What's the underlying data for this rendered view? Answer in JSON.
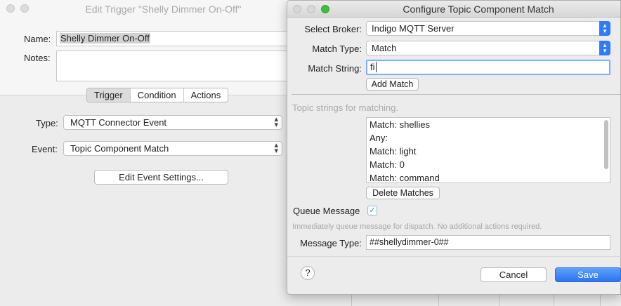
{
  "back_window": {
    "title": "Edit Trigger \"Shelly Dimmer On-Off\"",
    "name_label": "Name:",
    "name_value": "Shelly Dimmer On-Off",
    "notes_label": "Notes:",
    "notes_value": "",
    "tabs": [
      {
        "label": "Trigger",
        "selected": true
      },
      {
        "label": "Condition",
        "selected": false
      },
      {
        "label": "Actions",
        "selected": false
      }
    ],
    "type_label": "Type:",
    "type_value": "MQTT Connector Event",
    "event_label": "Event:",
    "event_value": "Topic Component Match",
    "edit_settings_button": "Edit Event Settings..."
  },
  "dialog": {
    "title": "Configure Topic Component Match",
    "broker_label": "Select Broker:",
    "broker_value": "Indigo MQTT Server",
    "match_type_label": "Match Type:",
    "match_type_value": "Match",
    "match_string_label": "Match String:",
    "match_string_value": "fi",
    "add_match_button": "Add Match",
    "topic_hint": "Topic strings for matching.",
    "matches": [
      "Match: shellies",
      "Any:",
      "Match: light",
      "Match: 0",
      "Match: command"
    ],
    "delete_matches_button": "Delete Matches",
    "queue_message_label": "Queue Message",
    "queue_message_checked": true,
    "queue_hint": "Immediately queue message for dispatch.  No additional actions required.",
    "message_type_label": "Message Type:",
    "message_type_value": "##shellydimmer-0##",
    "help_label": "?",
    "cancel_button": "Cancel",
    "save_button": "Save"
  },
  "colors": {
    "accent": "#2f7cf6",
    "close_dot": "#d7d7d7",
    "zoom_dot": "#3fbf3f"
  }
}
